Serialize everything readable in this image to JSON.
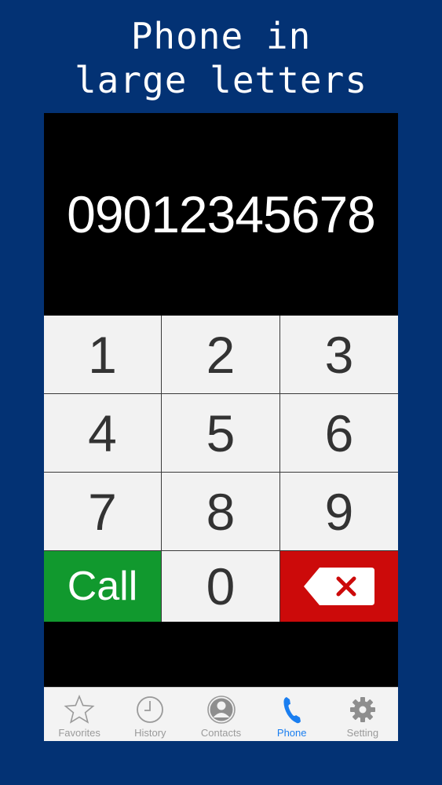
{
  "headline": {
    "line1": "Phone in",
    "line2": "large letters"
  },
  "display": {
    "number": "09012345678"
  },
  "keypad": {
    "keys": [
      "1",
      "2",
      "3",
      "4",
      "5",
      "6",
      "7",
      "8",
      "9"
    ],
    "call_label": "Call",
    "zero_label": "0"
  },
  "tabs": [
    {
      "label": "Favorites",
      "icon": "star-icon"
    },
    {
      "label": "History",
      "icon": "clock-icon"
    },
    {
      "label": "Contacts",
      "icon": "contact-icon"
    },
    {
      "label": "Phone",
      "icon": "phone-icon"
    },
    {
      "label": "Setting",
      "icon": "gear-icon"
    }
  ],
  "active_tab": "Phone",
  "colors": {
    "background": "#033274",
    "call": "#11992e",
    "delete": "#cc0a0a",
    "active_tab": "#1a7ef0",
    "inactive_tab": "#9a9a9a"
  }
}
